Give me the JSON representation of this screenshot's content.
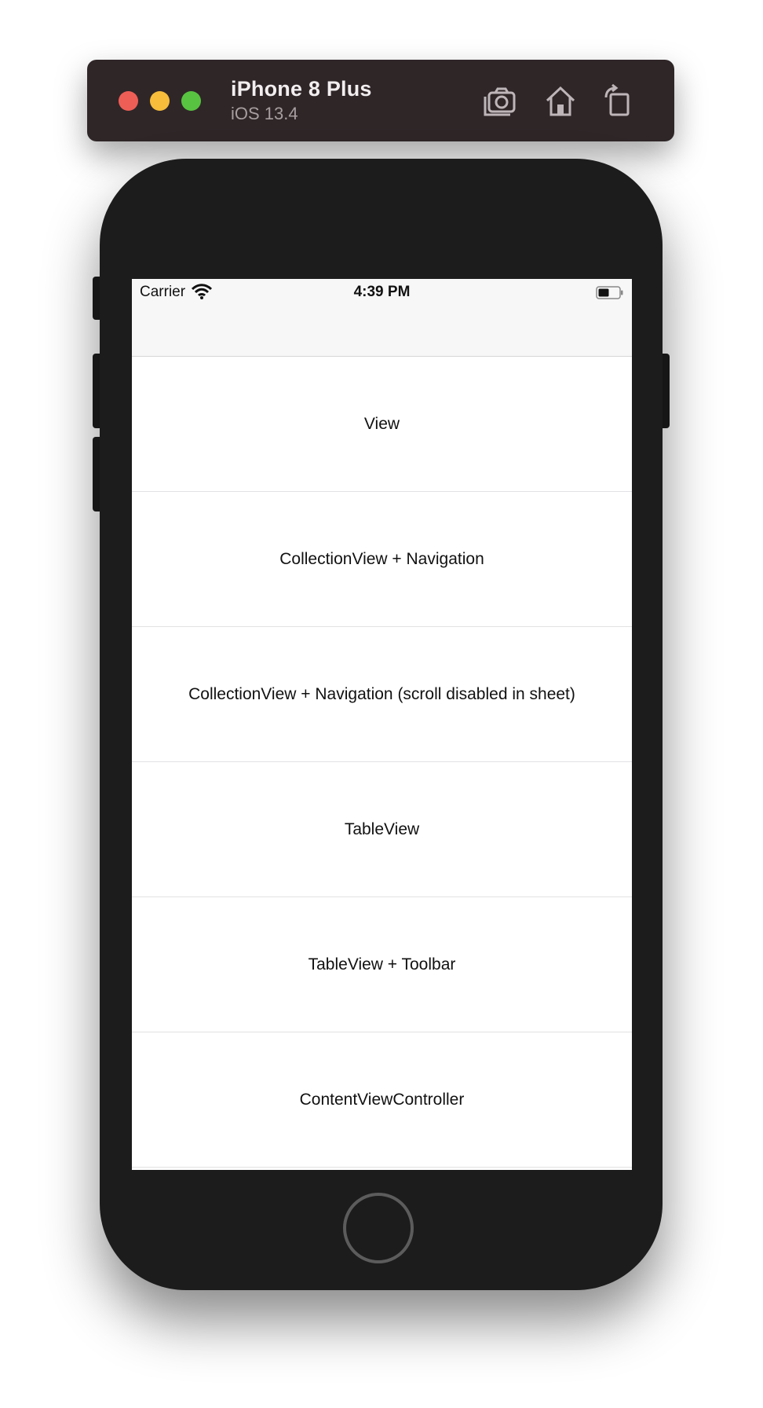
{
  "simulator": {
    "device_name": "iPhone 8 Plus",
    "os_version": "iOS 13.4",
    "toolbar_icons": [
      "camera-icon",
      "home-icon",
      "rotate-icon"
    ]
  },
  "status_bar": {
    "carrier": "Carrier",
    "time": "4:39 PM"
  },
  "list": {
    "items": [
      {
        "label": "View"
      },
      {
        "label": "CollectionView + Navigation"
      },
      {
        "label": "CollectionView + Navigation (scroll disabled in sheet)"
      },
      {
        "label": "TableView"
      },
      {
        "label": "TableView + Toolbar"
      },
      {
        "label": "ContentViewController"
      }
    ]
  },
  "colors": {
    "titlebar": "#2f2628",
    "close": "#ee5e56",
    "minimize": "#f7bd3b",
    "zoom": "#58c340",
    "phone_body": "#1c1c1c",
    "nav_background": "#f7f7f7"
  }
}
